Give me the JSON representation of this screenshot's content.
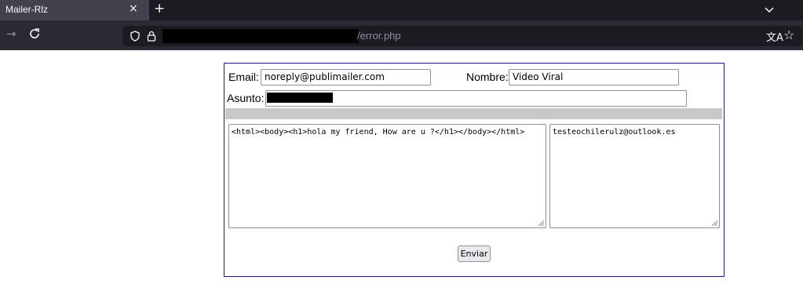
{
  "browser": {
    "tab_title": "Mailer-Rlz",
    "tab_close": "×",
    "new_tab": "+",
    "back_arrow": "→",
    "url_visible": "/error.php",
    "translate_glyph": "文A",
    "bookmark_glyph": "☆",
    "icons": [
      "close-icon",
      "plus-icon",
      "chevron-down-icon",
      "arrow-icon",
      "reload-icon",
      "shield-icon",
      "lock-icon",
      "translate-icon",
      "star-icon"
    ]
  },
  "form": {
    "email_label": "Email:",
    "email_value": "noreply@publimailer.com",
    "nombre_label": "Nombre:",
    "nombre_value": "Video Viral",
    "asunto_label": "Asunto:",
    "body_value": "<html><body><h1>hola my friend, How are u ?</h1></body></html>",
    "recipients_value": "testeochilerulz@outlook.es",
    "submit_label": "Enviar"
  },
  "colors": {
    "form_border": "#1b1ba8",
    "separator": "#c8c8c8",
    "chrome_dark": "#1c1b22",
    "chrome_mid": "#2b2a33"
  }
}
